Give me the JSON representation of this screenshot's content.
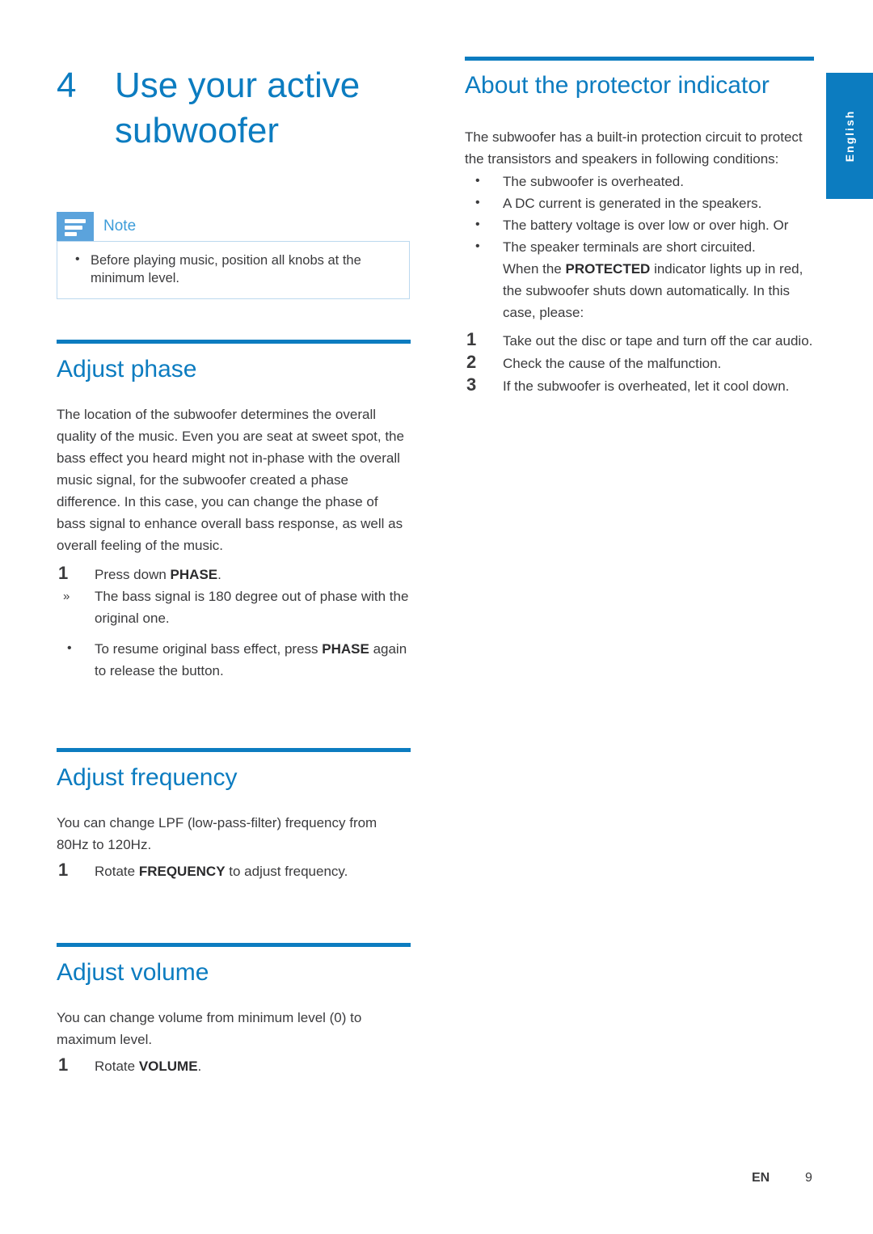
{
  "colors": {
    "accent_blue": "#0c7cc0",
    "note_blue": "#5ba3dc",
    "note_label_blue": "#3c9cd9",
    "body_text": "#3b3b3d"
  },
  "language_tab": {
    "label": "English"
  },
  "chapter": {
    "number": "4",
    "title": "Use your active subwoofer"
  },
  "note": {
    "label": "Note",
    "items": [
      "Before playing music, position all knobs at the minimum level."
    ]
  },
  "left_column": {
    "sections": [
      {
        "title": "Adjust phase",
        "paragraphs": [
          "The location of the subwoofer determines the overall quality of the music. Even you are seat at sweet spot, the bass effect you heard might not in-phase with the overall music signal, for the subwoofer created a phase difference. In this case, you can change the phase of bass signal to enhance overall bass response, as well as overall feeling of the music."
        ],
        "steps": [
          {
            "num": "1",
            "text_pre": "Press down ",
            "text_bold": "PHASE",
            "text_post": "."
          }
        ],
        "subnotes": [
          "The bass signal is 180 degree out of phase with the original one."
        ],
        "bullets": [
          {
            "pre": "To resume original bass effect, press ",
            "bold": "PHASE",
            "post": " again to release the button."
          }
        ]
      },
      {
        "title": "Adjust frequency",
        "paragraphs": [
          "You can change LPF (low-pass-filter) frequency from 80Hz to 120Hz."
        ],
        "steps": [
          {
            "num": "1",
            "text_pre": "Rotate ",
            "text_bold": "FREQUENCY",
            "text_post": " to adjust frequency."
          }
        ]
      },
      {
        "title": "Adjust volume",
        "paragraphs": [
          "You can change volume from minimum level (0) to maximum level."
        ],
        "steps": [
          {
            "num": "1",
            "text_pre": "Rotate ",
            "text_bold": "VOLUME",
            "text_post": "."
          }
        ]
      }
    ]
  },
  "right_column": {
    "section": {
      "title": "About the protector indicator",
      "intro": "The subwoofer has a built-in protection circuit to protect the transistors and speakers in following conditions:",
      "conditions": [
        "The subwoofer is overheated.",
        "A DC current is generated in the speakers.",
        "The battery voltage is over low or over high. Or",
        "The speaker terminals are short circuited."
      ],
      "protected_note": {
        "pre": "When the ",
        "bold": "PROTECTED",
        "post": " indicator lights up in red, the subwoofer shuts down automatically. In this case, please:"
      },
      "steps": [
        {
          "num": "1",
          "text": "Take out the disc or tape and turn off the car audio."
        },
        {
          "num": "2",
          "text": "Check the cause of the malfunction."
        },
        {
          "num": "3",
          "text": "If the subwoofer is overheated, let it cool down."
        }
      ]
    }
  },
  "footer": {
    "language_code": "EN",
    "page_number": "9"
  }
}
